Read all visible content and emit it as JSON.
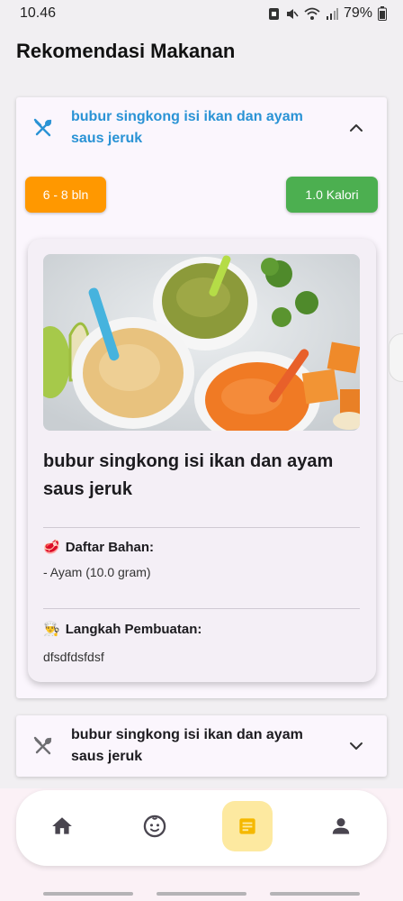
{
  "status_bar": {
    "time": "10.46",
    "battery": "79%"
  },
  "page": {
    "title": "Rekomendasi Makanan"
  },
  "recipes": [
    {
      "title": "bubur singkong isi ikan dan ayam saus jeruk",
      "expanded": true,
      "age_badge": "6 - 8 bln",
      "calorie_badge": "1.0 Kalori",
      "name": "bubur singkong isi ikan dan ayam saus jeruk",
      "ingredients_heading": "Daftar Bahan:",
      "ingredients_emoji": "🥩",
      "ingredients": [
        "- Ayam (10.0 gram)"
      ],
      "steps_heading": "Langkah Pembuatan:",
      "steps_emoji": "👨‍🍳",
      "steps": "dfsdfdsfdsf"
    },
    {
      "title": "bubur singkong isi ikan dan ayam saus jeruk",
      "expanded": false
    }
  ],
  "colors": {
    "accent_blue": "#2a93d5",
    "age_badge": "#ff9800",
    "calorie_badge": "#4caf50",
    "nav_active": "#fde9a0",
    "nav_active_icon": "#f5b800"
  },
  "bottom_nav": {
    "items": [
      {
        "icon": "home-icon",
        "active": false
      },
      {
        "icon": "baby-face-icon",
        "active": false
      },
      {
        "icon": "recipe-note-icon",
        "active": true
      },
      {
        "icon": "person-icon",
        "active": false
      }
    ]
  }
}
